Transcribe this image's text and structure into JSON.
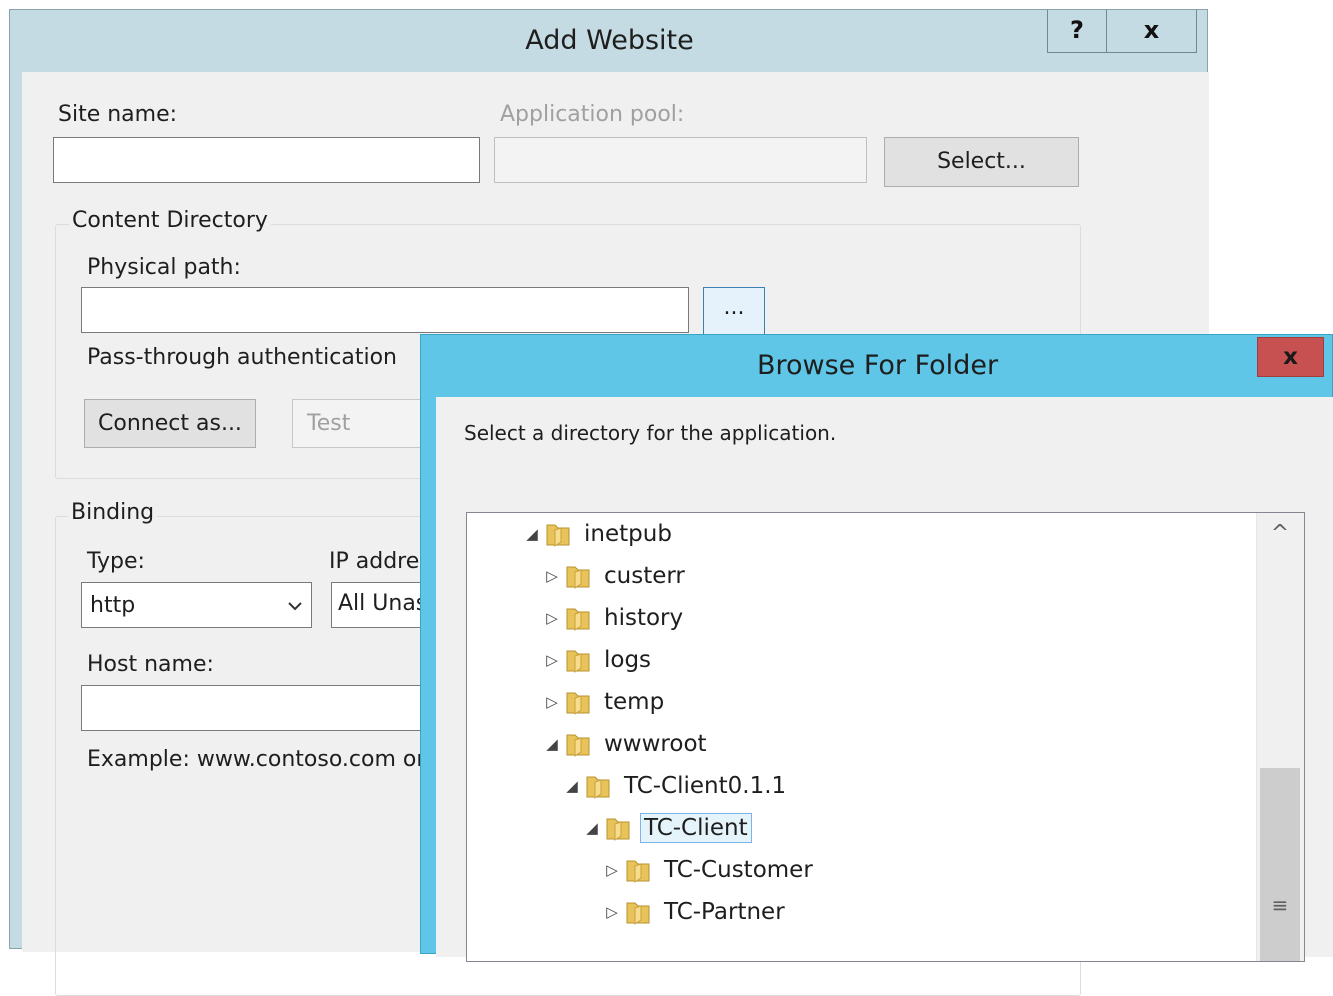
{
  "add_website": {
    "title": "Add Website",
    "help_button": "?",
    "close_button": "x",
    "site_name": {
      "label": "Site name:",
      "value": ""
    },
    "application_pool": {
      "label": "Application pool:",
      "value": ""
    },
    "select_button": "Select...",
    "content_directory": {
      "legend": "Content Directory",
      "physical_path_label": "Physical path:",
      "physical_path_value": "",
      "browse_button": "...",
      "pass_through_label": "Pass-through authentication",
      "connect_as_button": "Connect as...",
      "test_settings_button": "Test Settings..."
    },
    "binding": {
      "legend": "Binding",
      "type_label": "Type:",
      "type_value": "http",
      "ip_address_label": "IP address:",
      "ip_address_value": "All Unassigned",
      "host_name_label": "Host name:",
      "host_name_value": "",
      "example_text": "Example: www.contoso.com or"
    }
  },
  "browse_for_folder": {
    "title": "Browse For Folder",
    "close_button": "x",
    "instruction": "Select a directory for the application.",
    "scroll_up_glyph": "^",
    "scroll_grip_glyph": "≡",
    "tree": [
      {
        "label": "inetpub",
        "state": "expanded",
        "level": 0,
        "selected": false
      },
      {
        "label": "custerr",
        "state": "collapsed",
        "level": 1,
        "selected": false
      },
      {
        "label": "history",
        "state": "collapsed",
        "level": 1,
        "selected": false
      },
      {
        "label": "logs",
        "state": "collapsed",
        "level": 1,
        "selected": false
      },
      {
        "label": "temp",
        "state": "collapsed",
        "level": 1,
        "selected": false
      },
      {
        "label": "wwwroot",
        "state": "expanded",
        "level": 1,
        "selected": false
      },
      {
        "label": "TC-Client0.1.1",
        "state": "expanded",
        "level": 2,
        "selected": false
      },
      {
        "label": "TC-Client",
        "state": "expanded",
        "level": 3,
        "selected": true
      },
      {
        "label": "TC-Customer",
        "state": "collapsed",
        "level": 4,
        "selected": false
      },
      {
        "label": "TC-Partner",
        "state": "collapsed",
        "level": 4,
        "selected": false
      }
    ]
  },
  "colors": {
    "add_frame": "#c5dbe3",
    "browse_frame": "#5fc6e8",
    "close_red": "#c75050",
    "folder_yellow": "#e8c35a",
    "selection": "#e5f3fb"
  },
  "icons": {
    "expanded": "expanded-triangle-icon",
    "collapsed": "collapsed-triangle-icon",
    "folder": "folder-icon",
    "dropdown": "chevron-down-icon"
  }
}
